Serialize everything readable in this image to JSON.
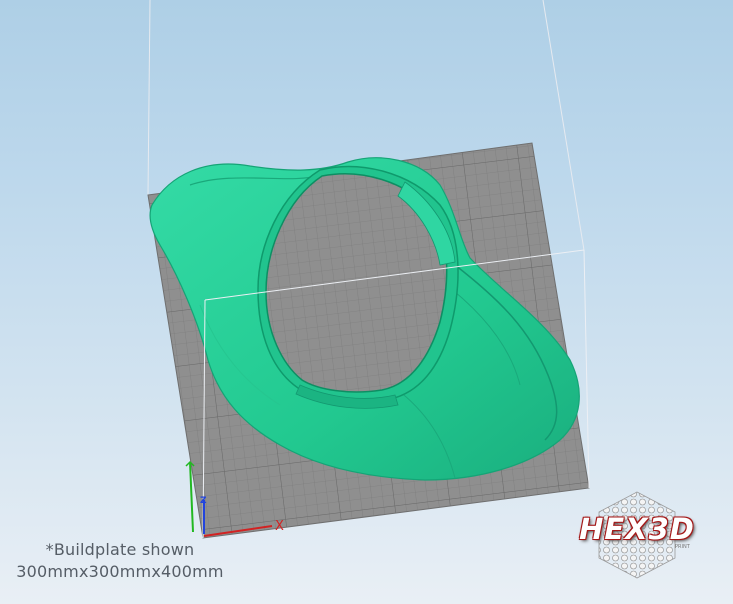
{
  "caption": {
    "line1": "*Buildplate shown",
    "line2": "300mmx300mmx400mm"
  },
  "logo": {
    "text": "HEX3D",
    "sub": "PRINT"
  },
  "axis_gizmo": {
    "z_label": "Z",
    "x_label": "X"
  },
  "colors": {
    "model": "#2bd39a",
    "model_shadow": "#17a87a",
    "buildplate": "#8e8e8e",
    "grid_line": "#7c7c7c",
    "bounding_box": "#e4e8ee",
    "logo_red": "#a41818"
  }
}
